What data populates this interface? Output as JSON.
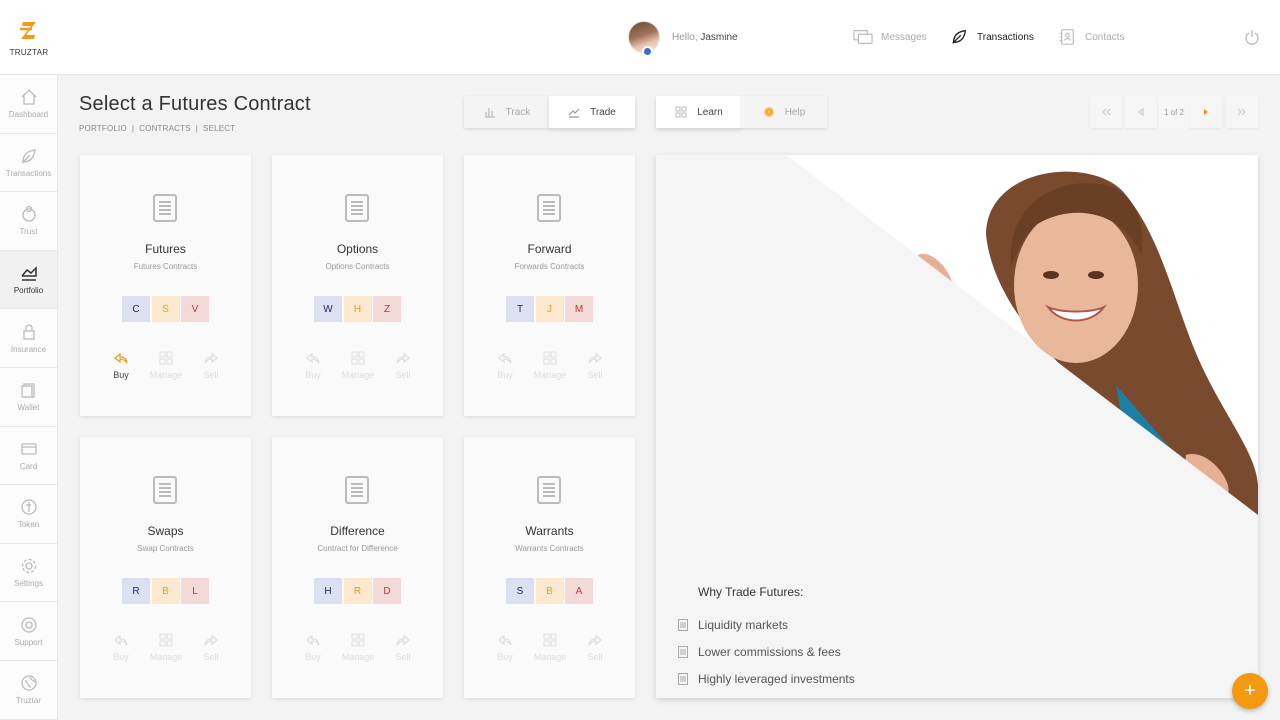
{
  "app": {
    "name": "TRUZTAR",
    "accent": "#f39a12"
  },
  "header": {
    "greeting": "Hello,",
    "user_name": "Jasmine",
    "nav": [
      {
        "label": "Messages",
        "icon": "messages-icon",
        "active": false
      },
      {
        "label": "Transactions",
        "icon": "transactions-icon",
        "active": true
      },
      {
        "label": "Contacts",
        "icon": "contacts-icon",
        "active": false
      }
    ]
  },
  "sidebar": {
    "items": [
      {
        "label": "Dashboard",
        "icon": "home-icon"
      },
      {
        "label": "Transactions",
        "icon": "leaf-icon"
      },
      {
        "label": "Trust",
        "icon": "trust-icon"
      },
      {
        "label": "Portfolio",
        "icon": "chart-icon",
        "active": true
      },
      {
        "label": "Insurance",
        "icon": "lock-icon"
      },
      {
        "label": "Wallet",
        "icon": "wallet-icon"
      },
      {
        "label": "Card",
        "icon": "card-icon"
      },
      {
        "label": "Token",
        "icon": "token-icon"
      },
      {
        "label": "Settings",
        "icon": "gear-icon"
      },
      {
        "label": "Support",
        "icon": "support-icon"
      },
      {
        "label": "Truztar",
        "icon": "globe-icon"
      }
    ]
  },
  "page": {
    "title": "Select a Futures Contract",
    "breadcrumb": [
      "PORTFOLIO",
      "CONTRACTS",
      "SELECT"
    ],
    "separator": "|"
  },
  "tabs": [
    {
      "label": "Track",
      "icon": "bar-chart-icon",
      "active": false
    },
    {
      "label": "Trade",
      "icon": "trade-icon",
      "active": true
    },
    {
      "label": "Learn",
      "icon": "grid-icon",
      "active": true
    },
    {
      "label": "Help",
      "icon": "help-icon",
      "active": false
    }
  ],
  "pager": {
    "info": "1 of 2"
  },
  "cards": [
    {
      "title": "Futures",
      "subtitle": "Futures Contracts",
      "badges": [
        "C",
        "S",
        "V"
      ],
      "actions": [
        "Buy",
        "Manage",
        "Sell"
      ],
      "active_action": 0
    },
    {
      "title": "Options",
      "subtitle": "Options Contracts",
      "badges": [
        "W",
        "H",
        "Z"
      ],
      "actions": [
        "Buy",
        "Manage",
        "Sell"
      ]
    },
    {
      "title": "Forward",
      "subtitle": "Forwards Contracts",
      "badges": [
        "T",
        "J",
        "M"
      ],
      "actions": [
        "Buy",
        "Manage",
        "Sell"
      ]
    },
    {
      "title": "Swaps",
      "subtitle": "Swap Contracts",
      "badges": [
        "R",
        "B",
        "L"
      ],
      "actions": [
        "Buy",
        "Manage",
        "Sell"
      ]
    },
    {
      "title": "Difference",
      "subtitle": "Contract for Difference",
      "badges": [
        "H",
        "R",
        "D"
      ],
      "actions": [
        "Buy",
        "Manage",
        "Sell"
      ]
    },
    {
      "title": "Warrants",
      "subtitle": "Warrants Contracts",
      "badges": [
        "S",
        "B",
        "A"
      ],
      "actions": [
        "Buy",
        "Manage",
        "Sell"
      ]
    }
  ],
  "promo": {
    "heading": "Why Trade Futures:",
    "items": [
      "Liquidity markets",
      "Lower commissions & fees",
      "Highly leveraged investments"
    ]
  },
  "fab": {
    "label": "+"
  }
}
